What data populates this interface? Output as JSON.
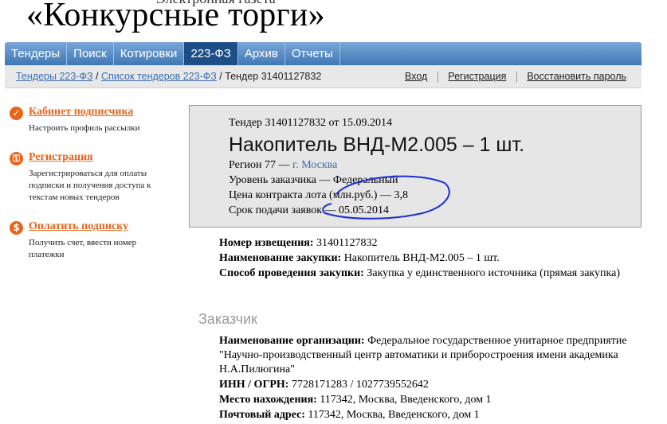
{
  "site": {
    "subtitle": "Электронная газета",
    "title": "«Конкурсные торги»"
  },
  "nav": {
    "tabs": [
      {
        "label": "Тендеры"
      },
      {
        "label": "Поиск"
      },
      {
        "label": "Котировки"
      },
      {
        "label": "223-ФЗ"
      },
      {
        "label": "Архив"
      },
      {
        "label": "Отчеты"
      }
    ],
    "active_index": 3
  },
  "breadcrumb": {
    "items": [
      "Тендеры 223-ФЗ",
      "Список тендеров 223-ФЗ",
      "Тендер 31401127832"
    ],
    "separator": "/"
  },
  "auth": {
    "login": "Вход",
    "register": "Регистрация",
    "restore": "Восстановить пароль"
  },
  "sidebar": {
    "items": [
      {
        "icon": "check-icon",
        "glyph": "✓",
        "title": "Кабинет подписчика",
        "desc": "Настроить профиль рассылки"
      },
      {
        "icon": "key-icon",
        "glyph": "⚿",
        "title": "Регистрация",
        "desc": "Зарегистрироваться для оплаты подписки и получения доступа к текстам новых тендеров"
      },
      {
        "icon": "dollar-icon",
        "glyph": "$",
        "title": "Оплатить подписку",
        "desc": "Получить счет, ввести номер платежки"
      }
    ]
  },
  "summary": {
    "tender_line": "Тендер 31401127832 от 15.09.2014",
    "title": "Накопитель ВНД-М2.005 – 1 шт.",
    "region_prefix": "Регион 77 —",
    "region_link": "г. Москва",
    "level": "Уровень заказчика — Федеральный",
    "price": "Цена контракта лота (млн.руб.) — 3,8",
    "deadline": "Срок подачи заявок — 05.05.2014"
  },
  "details": {
    "notice_label": "Номер извещения:",
    "notice_value": "31401127832",
    "name_label": "Наименование закупки:",
    "name_value": "Накопитель ВНД-М2.005 – 1 шт.",
    "method_label": "Способ проведения закупки:",
    "method_value": "Закупка у единственного источника (прямая закупка)"
  },
  "customer": {
    "heading": "Заказчик",
    "org_label": "Наименование организации:",
    "org_value": "Федеральное государственное унитарное предприятие \"Научно-производственный центр автоматики и приборостроения имени академика Н.А.Пилюгина\"",
    "inn_label": "ИНН / ОГРН:",
    "inn_value": "7728171283 / 1027739552642",
    "location_label": "Место нахождения:",
    "location_value": "117342, Москва, Введенского, дом 1",
    "postal_label": "Почтовый адрес:",
    "postal_value": "117342, Москва, Введенского, дом 1"
  },
  "colors": {
    "nav_top": "#7aa6d6",
    "nav_bottom": "#3f78b6",
    "nav_active": "#1d4e88",
    "accent": "#e8641b",
    "link": "#3a6fb0",
    "annotation": "#1a2fd0"
  }
}
